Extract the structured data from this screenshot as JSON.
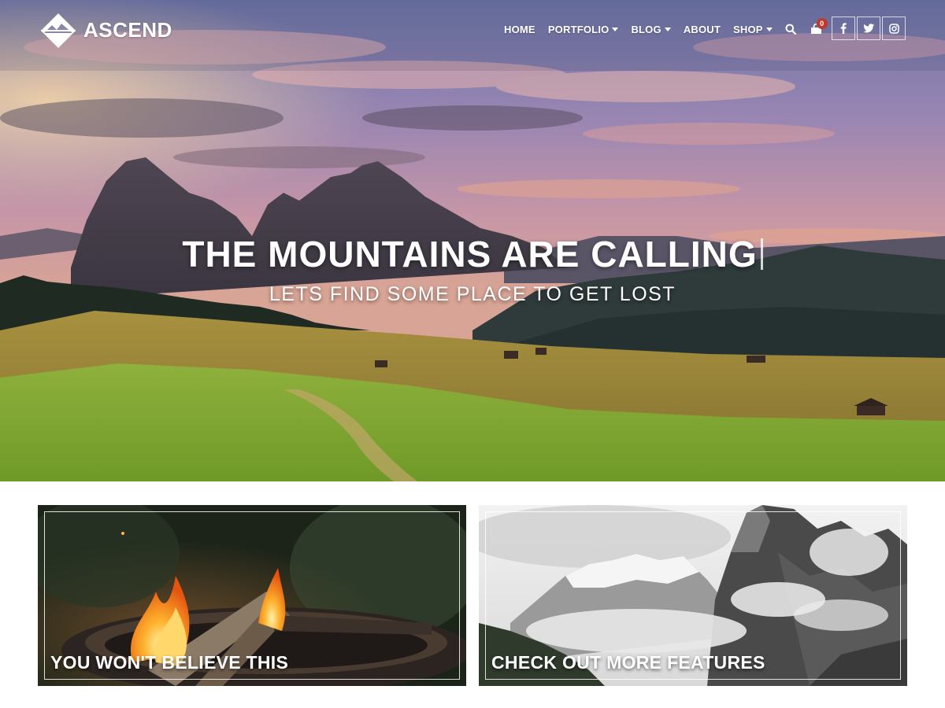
{
  "brand": {
    "name": "ASCEND"
  },
  "nav": {
    "items": [
      {
        "label": "HOME",
        "has_dropdown": false
      },
      {
        "label": "PORTFOLIO",
        "has_dropdown": true
      },
      {
        "label": "BLOG",
        "has_dropdown": true
      },
      {
        "label": "ABOUT",
        "has_dropdown": false
      },
      {
        "label": "SHOP",
        "has_dropdown": true
      }
    ],
    "search_icon": "search-icon",
    "cart_icon": "shopping-bag-icon",
    "cart_count": "0"
  },
  "social": [
    {
      "icon": "facebook-icon",
      "glyph": "f"
    },
    {
      "icon": "twitter-icon",
      "glyph": "t"
    },
    {
      "icon": "instagram-icon",
      "glyph": "o"
    }
  ],
  "hero": {
    "title": "THE MOUNTAINS ARE CALLING",
    "subtitle": "LETS FIND SOME PLACE TO GET LOST"
  },
  "features": [
    {
      "label": "YOU WON'T BELIEVE THIS"
    },
    {
      "label": "CHECK OUT MORE FEATURES"
    }
  ],
  "colors": {
    "badge": "#c0392b",
    "text": "#ffffff"
  }
}
